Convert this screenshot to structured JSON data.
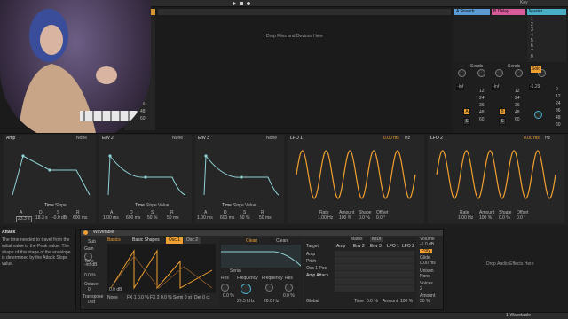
{
  "top": {
    "drop_hint": "Drop Files and Devices Here",
    "transport_hint": "Key"
  },
  "returns": {
    "a_label": "A Reverb",
    "b_label": "B Delay",
    "master_label": "Master",
    "sends_label": "Sends",
    "db_values_a": [
      "-Inf",
      "12",
      "24",
      "36",
      "48",
      "60"
    ],
    "db_values_b": [
      "-Inf",
      "12",
      "24",
      "36",
      "48",
      "60"
    ],
    "master_db": "-6.29",
    "master_scale": [
      "0",
      "12",
      "24",
      "36",
      "48",
      "60"
    ],
    "a_btn": "A",
    "b_btn": "B",
    "s_btn": "S",
    "slots": [
      "1",
      "2",
      "3",
      "4",
      "5",
      "6",
      "7",
      "8"
    ],
    "left_scale": [
      "12",
      "24",
      "36",
      "48",
      "60"
    ],
    "solo_label": "Solo"
  },
  "envelopes": [
    {
      "title": "Amp",
      "mode": "None",
      "tabs": [
        "Time",
        "Slope"
      ],
      "params": [
        "A",
        "D",
        "S",
        "R"
      ],
      "values": [
        "23.3 s",
        "18.3 s",
        "-0.0 dB",
        "600 ms"
      ]
    },
    {
      "title": "Env 2",
      "mode": "None",
      "tabs": [
        "Time",
        "Slope",
        "Value"
      ],
      "params": [
        "A",
        "D",
        "S",
        "R"
      ],
      "values": [
        "1.00 ms",
        "600 ms",
        "50 %",
        "50 ms"
      ]
    },
    {
      "title": "Env 3",
      "mode": "None",
      "tabs": [
        "Time",
        "Slope",
        "Value"
      ],
      "params": [
        "A",
        "D",
        "S",
        "R"
      ],
      "values": [
        "1.00 ms",
        "600 ms",
        "50 %",
        "50 ms"
      ]
    }
  ],
  "lfos": [
    {
      "title": "LFO 1",
      "time": "0.00 ms",
      "unit": "Hz",
      "params": [
        "Rate",
        "Amount",
        "Shape",
        "Offset"
      ],
      "values": [
        "1.00 Hz",
        "100 %",
        "0.0 %",
        "0.0 °"
      ]
    },
    {
      "title": "LFO 2",
      "time": "0.00 ms",
      "unit": "Hz",
      "params": [
        "Rate",
        "Amount",
        "Shape",
        "Offset"
      ],
      "values": [
        "1.00 Hz",
        "100 %",
        "0.0 %",
        "0.0 °"
      ]
    }
  ],
  "info": {
    "title": "Attack",
    "body": "The time needed to travel from the initial value to the Peak value. The shape of this stage of the envelope is determined by the Attack Slope value."
  },
  "wavetable": {
    "device": "Wavetable",
    "tabs": [
      "Osc 1",
      "Osc 2"
    ],
    "sub_label": "Sub",
    "gain_label": "Gain",
    "gain_value": "-inf dB",
    "tone_label": "Tone",
    "tone_value": "0.0 %",
    "octave_label": "Octave",
    "octave_value": "0",
    "transpose_label": "Transpose",
    "transpose_value": "0 st",
    "osc_category": "Basics",
    "osc_shape": "Basic Shapes",
    "osc_gain": "0.0 dB",
    "osc_none": "None",
    "osc_fx": [
      "FX 1 0.0 %",
      "FX 2 0.0 %",
      "Semi 0 st",
      "Det 0 ct"
    ],
    "filter_type": "Clean",
    "filter_mode": "Clean",
    "filter_circuit": "Serial",
    "res_label": "Res",
    "res_value": "0.0 %",
    "freq_label": "Frequency",
    "freq_value": "20.5 kHz",
    "freq2_label": "Frequency",
    "freq2_value": "20.0 Hz",
    "res2_label": "Res",
    "res2_value": "0.0 %",
    "mod_tabs": [
      "Matrix",
      "MIDI"
    ],
    "mod_columns": [
      "Target",
      "Amp",
      "Env 2",
      "Env 3",
      "LFO 1",
      "LFO 2"
    ],
    "mod_rows": [
      "Amp",
      "Pitch",
      "Osc 1 Pos",
      "Amp Attack"
    ],
    "global_label": "Global",
    "time_label": "Time",
    "time_value": "0.0 %",
    "amount_label": "Amount",
    "amount_value": "100 %",
    "volume_label": "Volume",
    "volume_value": "-6.0 dB",
    "poly_label": "Poly",
    "glide_label": "Glide",
    "glide_value": "0.00 ms",
    "unison_label": "Unison",
    "unison_value": "None",
    "voices_label": "Voices",
    "voices_value": "2",
    "amount2_label": "Amount",
    "amount2_value": "50 %",
    "audio_drop": "Drop Audio Effects Here"
  },
  "status": {
    "track_name": "1-Wavetable"
  },
  "colors": {
    "accent": "#f0a030",
    "envelope_line": "#8fd2d6",
    "lfo_line": "#f0a030",
    "return_a": "#5b9bd5",
    "return_b": "#d55b9b",
    "master": "#4ab0c8"
  }
}
